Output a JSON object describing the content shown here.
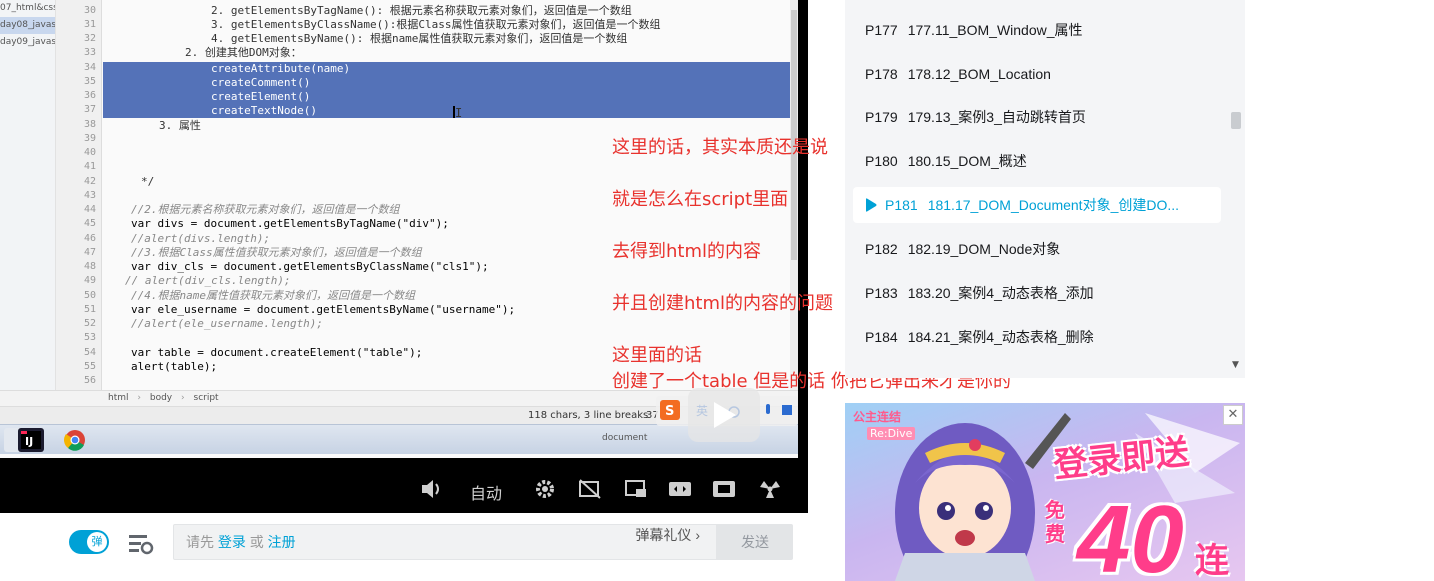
{
  "ide": {
    "files": [
      "07_html&css",
      "day08_javas",
      "day09_javas"
    ],
    "line_numbers": [
      "30",
      "31",
      "32",
      "33",
      "34",
      "35",
      "36",
      "37",
      "38",
      "39",
      "40",
      "41",
      "42",
      "43",
      "44",
      "45",
      "46",
      "47",
      "48",
      "49",
      "50",
      "51",
      "52",
      "53",
      "54",
      "55",
      "56"
    ],
    "code": [
      "2. getElementsByTagName(): 根据元素名称获取元素对象们，返回值是一个数组",
      "3. getElementsByClassName():根据Class属性值获取元素对象们，返回值是一个数组",
      "4. getElementsByName(): 根据name属性值获取元素对象们，返回值是一个数组",
      "2. 创建其他DOM对象：",
      "createAttribute(name)",
      "createComment()",
      "createElement()",
      "createTextNode()",
      "3. 属性",
      "",
      "",
      "",
      "*/",
      "",
      "//2.根据元素名称获取元素对象们，返回值是一个数组",
      "var divs = document.getElementsByTagName(\"div\");",
      "//alert(divs.length);",
      "//3.根据Class属性值获取元素对象们，返回值是一个数组",
      "var div_cls = document.getElementsByClassName(\"cls1\");",
      "// alert(div_cls.length);",
      "//4.根据name属性值获取元素对象们，返回值是一个数组",
      "var ele_username = document.getElementsByName(\"username\");",
      "//alert(ele_username.length);",
      "",
      "var table = document.createElement(\"table\");",
      "alert(table);",
      ""
    ],
    "breadcrumb": [
      "html",
      "body",
      "script"
    ],
    "status": "118 chars, 3 line breaks",
    "status_pos": "37",
    "taskbar_label": "document"
  },
  "player": {
    "auto_label": "自动"
  },
  "danmaku": {
    "toggle_label": "弹",
    "placeholder_prefix": "请先",
    "login": "登录",
    "or": "或",
    "register": "注册",
    "etiquette": "弹幕礼仪",
    "send": "发送"
  },
  "notes": [
    "这里的话，其实本质还是说",
    "就是怎么在script里面",
    "去得到html的内容",
    "并且创建html的内容的问题",
    "这里面的话",
    "创建了一个table  但是的话 你把它弹出来才是你的"
  ],
  "playlist": [
    {
      "no": "P177",
      "title": "177.11_BOM_Window_属性",
      "active": false
    },
    {
      "no": "P178",
      "title": "178.12_BOM_Location",
      "active": false
    },
    {
      "no": "P179",
      "title": "179.13_案例3_自动跳转首页",
      "active": false
    },
    {
      "no": "P180",
      "title": "180.15_DOM_概述",
      "active": false
    },
    {
      "no": "P181",
      "title": "181.17_DOM_Document对象_创建DO...",
      "active": true
    },
    {
      "no": "P182",
      "title": "182.19_DOM_Node对象",
      "active": false
    },
    {
      "no": "P183",
      "title": "183.20_案例4_动态表格_添加",
      "active": false
    },
    {
      "no": "P184",
      "title": "184.21_案例4_动态表格_删除",
      "active": false
    }
  ],
  "ad": {
    "logo_top": "公主连结",
    "logo_sub": "Re:Dive",
    "headline": "登录即送",
    "free": "免费",
    "number": "40",
    "suffix": "连",
    "close": "✕"
  },
  "colors": {
    "accent": "#00a1d6",
    "note_red": "#e8322d",
    "selection": "#5472b8"
  }
}
